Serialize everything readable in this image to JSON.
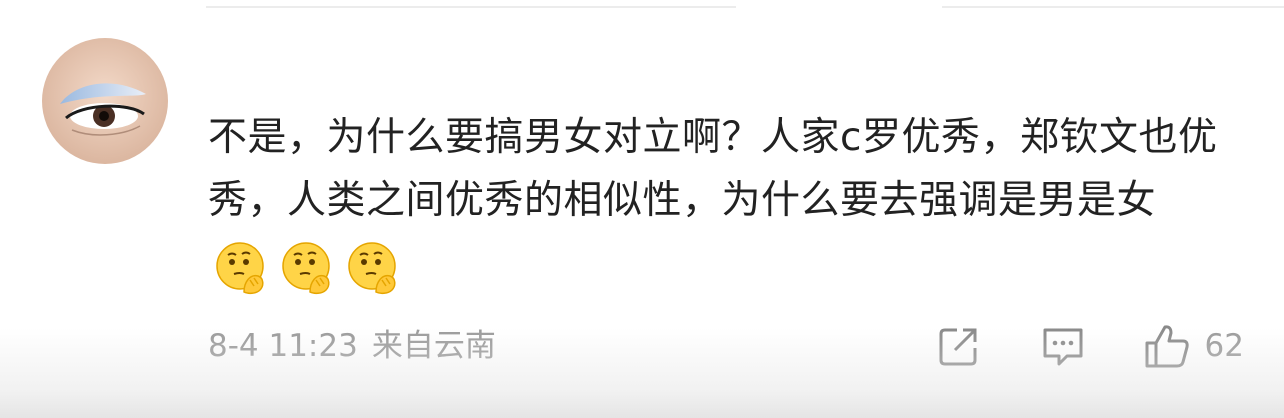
{
  "comment": {
    "text": "不是，为什么要搞男女对立啊？人家c罗优秀，郑钦文也优秀，人类之间优秀的相似性，为什么要去强调是男是女",
    "emojis": [
      "thinking-emoji",
      "thinking-emoji",
      "thinking-emoji"
    ],
    "timestamp": "8-4 11:23",
    "location": "来自云南",
    "like_count": "62"
  },
  "colors": {
    "text": "#222222",
    "meta": "#9b9b9b",
    "divider": "#ececec"
  },
  "icons": {
    "share": "share-icon",
    "comment": "comment-icon",
    "like": "thumbs-up-icon"
  }
}
